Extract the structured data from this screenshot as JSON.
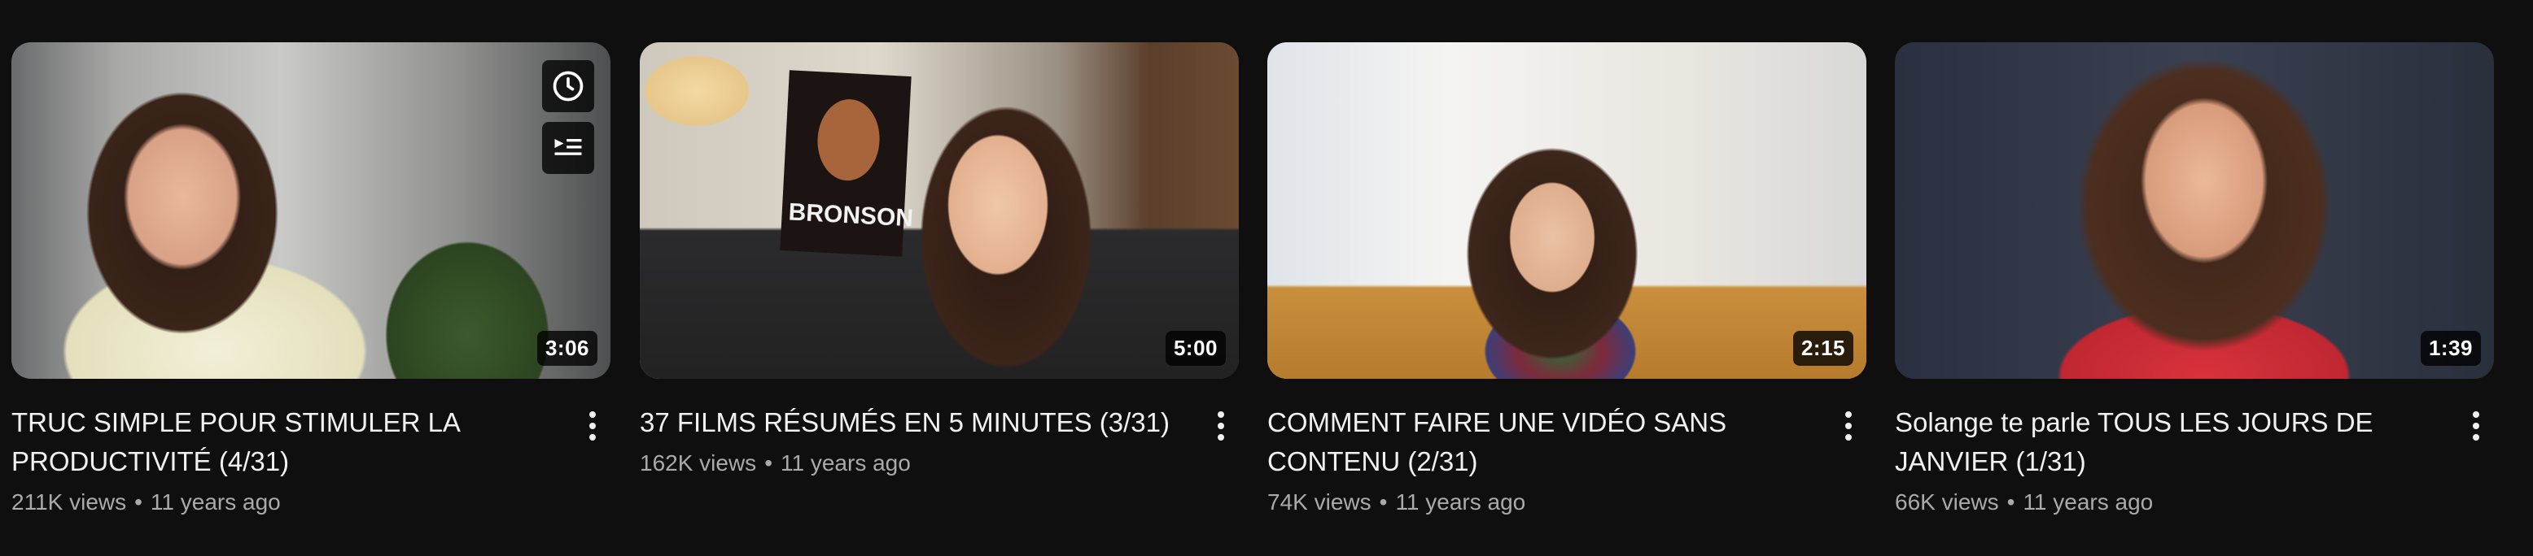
{
  "videos": [
    {
      "title": "TRUC SIMPLE POUR STIMULER LA PRODUCTIVITÉ (4/31)",
      "views": "211K views",
      "age": "11 years ago",
      "duration": "3:06",
      "hover_actions": [
        "clock-icon",
        "add-to-queue-icon"
      ]
    },
    {
      "title": "37 FILMS RÉSUMÉS EN 5 MINUTES (3/31)",
      "views": "162K views",
      "age": "11 years ago",
      "duration": "5:00",
      "thumbnail_text": "BRONSON"
    },
    {
      "title": "COMMENT FAIRE UNE VIDÉO SANS CONTENU (2/31)",
      "views": "74K views",
      "age": "11 years ago",
      "duration": "2:15"
    },
    {
      "title": "Solange te parle TOUS LES JOURS DE JANVIER (1/31)",
      "views": "66K views",
      "age": "11 years ago",
      "duration": "1:39"
    }
  ],
  "separator": "•",
  "colors": {
    "background": "#0f0f0f",
    "title": "#f1f1f1",
    "secondary": "#aaaaaa"
  }
}
